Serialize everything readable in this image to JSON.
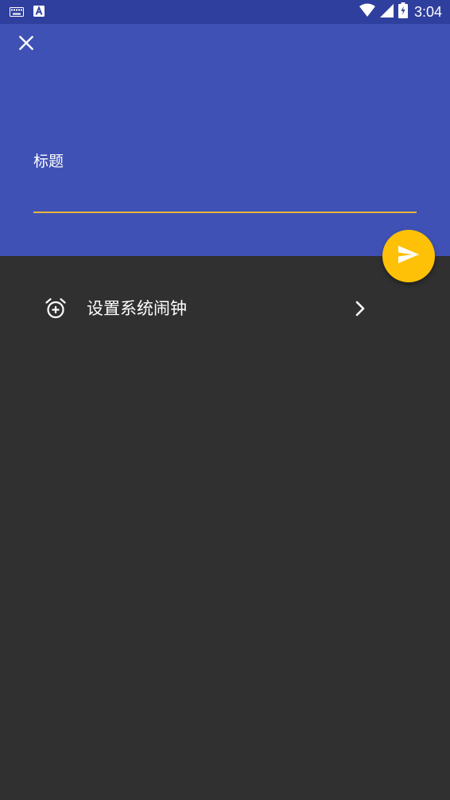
{
  "status_bar": {
    "time": "3:04",
    "icons": [
      "keyboard-icon",
      "a-notification-icon",
      "wifi-icon",
      "cell-signal-icon",
      "battery-charging-icon"
    ]
  },
  "app_bar": {
    "close_icon": "close-icon",
    "title_placeholder": "标题",
    "title_value": ""
  },
  "fab": {
    "icon": "send-icon",
    "color": "#ffc107"
  },
  "list": {
    "items": [
      {
        "label": "设置系统闹钟",
        "icon": "alarm-add-icon",
        "trailing_icon": "chevron-right-icon"
      }
    ]
  },
  "colors": {
    "status_bar": "#2f3f9e",
    "app_bar": "#3f51b5",
    "background": "#303030",
    "input_underline": "#e8b63a",
    "accent": "#ffc107"
  }
}
